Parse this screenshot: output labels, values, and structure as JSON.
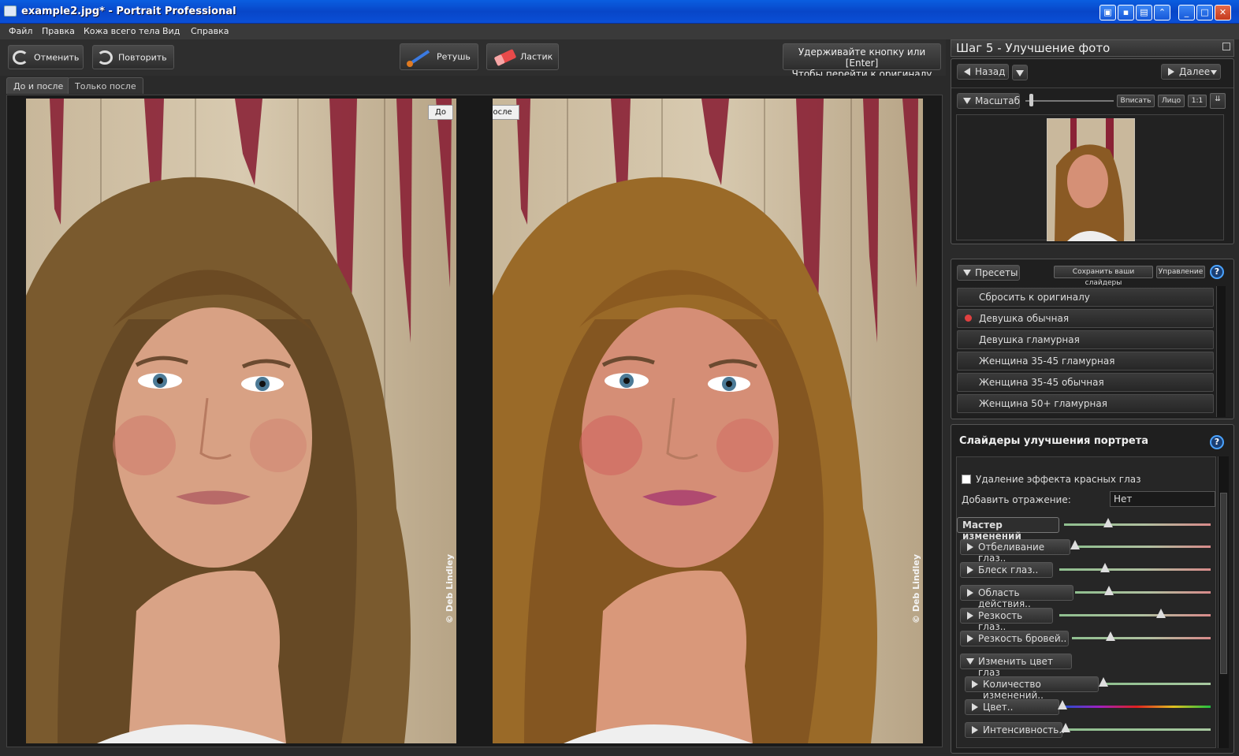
{
  "window": {
    "title": "example2.jpg* - Portrait Professional"
  },
  "menu": [
    "Файл",
    "Правка",
    "Кожа всего тела",
    "Вид",
    "Справка"
  ],
  "toolbar": {
    "undo": "Отменить",
    "redo": "Повторить",
    "retouch": "Ретушь",
    "eraser": "Ластик",
    "hint_line1": "Удерживайте кнопку или [Enter]",
    "hint_line2": "Чтобы перейти к оригиналу"
  },
  "tabs": [
    "До и после",
    "Только после"
  ],
  "viewer": {
    "before_label": "До",
    "after_label": "После",
    "credit": "© Deb Lindley"
  },
  "step_panel": {
    "title": "Шаг 5 - Улучшение фото",
    "back": "Назад",
    "next": "Далее",
    "zoom_label": "Масштаб",
    "fit": "Вписать",
    "face": "Лицо",
    "one_to_one": "1:1"
  },
  "presets": {
    "label": "Пресеты",
    "save": "Сохранить ваши слайдеры",
    "manage": "Управление",
    "items": [
      "Сбросить к оригиналу",
      "Девушка обычная",
      "Девушка гламурная",
      "Женщина 35-45 гламурная",
      "Женщина 35-45 обычная",
      "Женщина 50+ гламурная"
    ],
    "selected_index": 1
  },
  "sliders": {
    "title": "Слайдеры улучшения портрета",
    "red_eye": "Удаление эффекта красных глаз",
    "reflection_label": "Добавить отражение:",
    "reflection_value": "Нет",
    "master": {
      "label": "Мастер изменений",
      "value": 0.3
    },
    "items": [
      {
        "label": "Отбеливание глаз..",
        "value": 0.0
      },
      {
        "label": "Блеск глаз..",
        "value": 0.3
      },
      {
        "label": "Область действия..",
        "value": 0.25
      },
      {
        "label": "Резкость глаз..",
        "value": 0.67
      },
      {
        "label": "Резкость бровей..",
        "value": 0.28
      }
    ],
    "eye_color_group": "Изменить цвет глаз",
    "eye_items": [
      {
        "label": "Количество изменений..",
        "value": 0.0
      },
      {
        "label": "Цвет..",
        "value": 0.0
      },
      {
        "label": "Интенсивность..",
        "value": 0.0
      }
    ]
  },
  "colors": {
    "accent": "#4aa3ff",
    "title_blue": "#0846c8",
    "wood_red": "#8a2236"
  }
}
